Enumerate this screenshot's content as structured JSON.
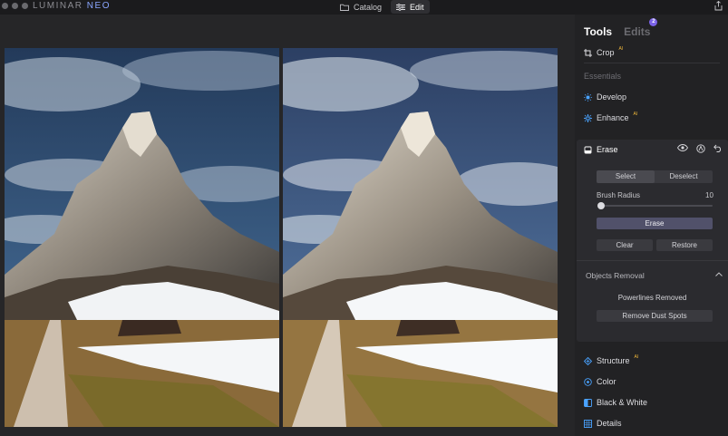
{
  "app": {
    "logo_text": "LUMINAR",
    "logo_accent": "NEO",
    "top_tabs": [
      {
        "label": "Catalog",
        "icon": "folder-icon"
      },
      {
        "label": "Edit",
        "icon": "sliders-icon",
        "active": true
      }
    ]
  },
  "panel": {
    "tabs": {
      "tools": "Tools",
      "edits": "Edits",
      "edits_badge": "2"
    },
    "crop_label": "Crop",
    "ai_mark": "AI",
    "essentials_label": "Essentials",
    "develop_label": "Develop",
    "enhance_label": "Enhance",
    "erase": {
      "title": "Erase",
      "select_label": "Select",
      "deselect_label": "Deselect",
      "brush_radius_label": "Brush Radius",
      "brush_radius_value": "10",
      "brush_radius_fraction": 0.02,
      "erase_button": "Erase",
      "clear_button": "Clear",
      "restore_button": "Restore",
      "objects_removal_label": "Objects Removal",
      "powerlines_label": "Powerlines Removed",
      "remove_dust_button": "Remove Dust Spots"
    },
    "structure_label": "Structure",
    "color_label": "Color",
    "bw_label": "Black & White",
    "details_label": "Details"
  },
  "colors": {
    "accent": "#7b63e8",
    "icon_blue": "#4aa3ff",
    "ai_badge": "#f0b73a"
  }
}
